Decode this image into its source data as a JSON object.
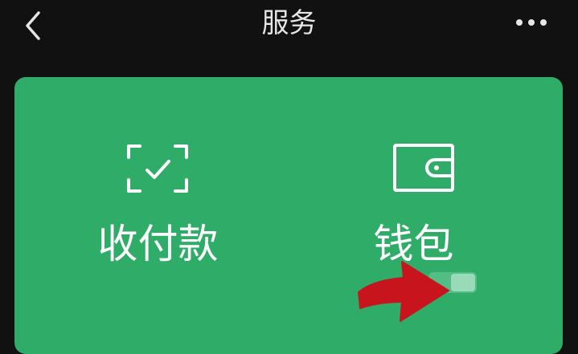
{
  "header": {
    "title": "服务",
    "back_icon": "chevron-left-icon",
    "more_icon": "more-horizontal-icon"
  },
  "card": {
    "color": "#2eac68",
    "items": [
      {
        "label": "收付款",
        "icon": "scan-check-icon"
      },
      {
        "label": "钱包",
        "icon": "wallet-icon"
      }
    ]
  },
  "annotation": {
    "arrow_color": "#c8141c",
    "arrow_icon": "red-arrow-annotation"
  }
}
